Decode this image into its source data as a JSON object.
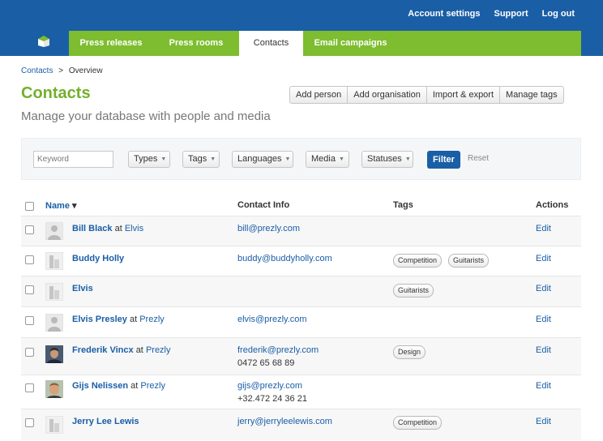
{
  "nav": {
    "top_links": [
      "Account settings",
      "Support",
      "Log out"
    ],
    "tabs": [
      {
        "label": "Press releases",
        "active": false
      },
      {
        "label": "Press rooms",
        "active": false
      },
      {
        "label": "Contacts",
        "active": true
      },
      {
        "label": "Email campaigns",
        "active": false
      }
    ]
  },
  "breadcrumb": {
    "root": "Contacts",
    "separator": ">",
    "current": "Overview"
  },
  "page": {
    "title": "Contacts",
    "subtitle": "Manage your database with people and media",
    "actions": [
      "Add person",
      "Add organisation",
      "Import & export",
      "Manage tags"
    ]
  },
  "filters": {
    "keyword_placeholder": "Keyword",
    "dropdowns": [
      "Types",
      "Tags",
      "Languages",
      "Media",
      "Statuses"
    ],
    "filter_label": "Filter",
    "reset_label": "Reset"
  },
  "table": {
    "headers": {
      "name": "Name",
      "contact": "Contact Info",
      "tags": "Tags",
      "actions": "Actions"
    },
    "sort_indicator": "▾",
    "rows": [
      {
        "name": "Bill Black",
        "at": "at",
        "org": "Elvis",
        "avatar": "person-placeholder",
        "email": "bill@prezly.com",
        "phone": "",
        "tags": [],
        "action": "Edit"
      },
      {
        "name": "Buddy Holly",
        "at": "",
        "org": "",
        "avatar": "organisation-placeholder",
        "email": "buddy@buddyholly.com",
        "phone": "",
        "tags": [
          "Competition",
          "Guitarists"
        ],
        "action": "Edit"
      },
      {
        "name": "Elvis",
        "at": "",
        "org": "",
        "avatar": "organisation-placeholder",
        "email": "",
        "phone": "",
        "tags": [
          "Guitarists"
        ],
        "action": "Edit"
      },
      {
        "name": "Elvis Presley",
        "at": "at",
        "org": "Prezly",
        "avatar": "person-placeholder",
        "email": "elvis@prezly.com",
        "phone": "",
        "tags": [],
        "action": "Edit"
      },
      {
        "name": "Frederik Vincx",
        "at": "at",
        "org": "Prezly",
        "avatar": "photo",
        "email": "frederik@prezly.com",
        "phone": "0472 65 68 89",
        "tags": [
          "Design"
        ],
        "action": "Edit"
      },
      {
        "name": "Gijs Nelissen",
        "at": "at",
        "org": "Prezly",
        "avatar": "photo",
        "email": "gijs@prezly.com",
        "phone": "+32.472 24 36 21",
        "tags": [],
        "action": "Edit"
      },
      {
        "name": "Jerry Lee Lewis",
        "at": "",
        "org": "",
        "avatar": "organisation-placeholder",
        "email": "jerry@jerryleelewis.com",
        "phone": "",
        "tags": [
          "Competition"
        ],
        "action": "Edit"
      }
    ]
  },
  "colors": {
    "brand_blue": "#1a5ea6",
    "nav_green": "#7dbd2f",
    "title_green": "#73b02b"
  }
}
